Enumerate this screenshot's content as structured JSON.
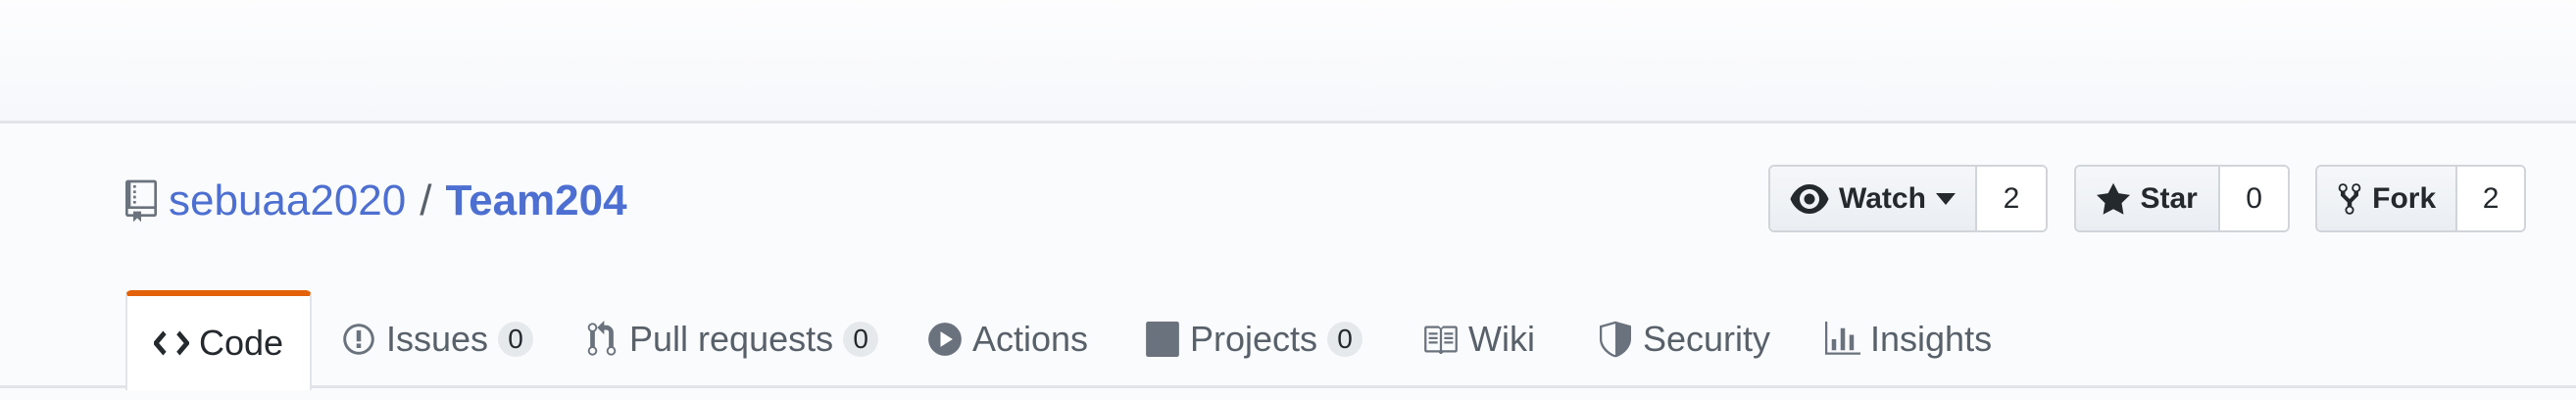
{
  "repo": {
    "owner": "sebuaa2020",
    "separator": "/",
    "name": "Team204"
  },
  "actions": {
    "watch": {
      "label": "Watch",
      "count": "2"
    },
    "star": {
      "label": "Star",
      "count": "0"
    },
    "fork": {
      "label": "Fork",
      "count": "2"
    }
  },
  "tabs": [
    {
      "label": "Code",
      "icon": "code-icon",
      "selected": true
    },
    {
      "label": "Issues",
      "icon": "issue-icon",
      "counter": "0"
    },
    {
      "label": "Pull requests",
      "icon": "pull-request-icon",
      "counter": "0"
    },
    {
      "label": "Actions",
      "icon": "play-icon"
    },
    {
      "label": "Projects",
      "icon": "project-icon",
      "counter": "0"
    },
    {
      "label": "Wiki",
      "icon": "book-icon"
    },
    {
      "label": "Security",
      "icon": "shield-icon"
    },
    {
      "label": "Insights",
      "icon": "graph-icon"
    }
  ],
  "colors": {
    "link": "#4c6fd1",
    "selected_tab_accent": "#e36209",
    "muted_text": "#586069"
  }
}
